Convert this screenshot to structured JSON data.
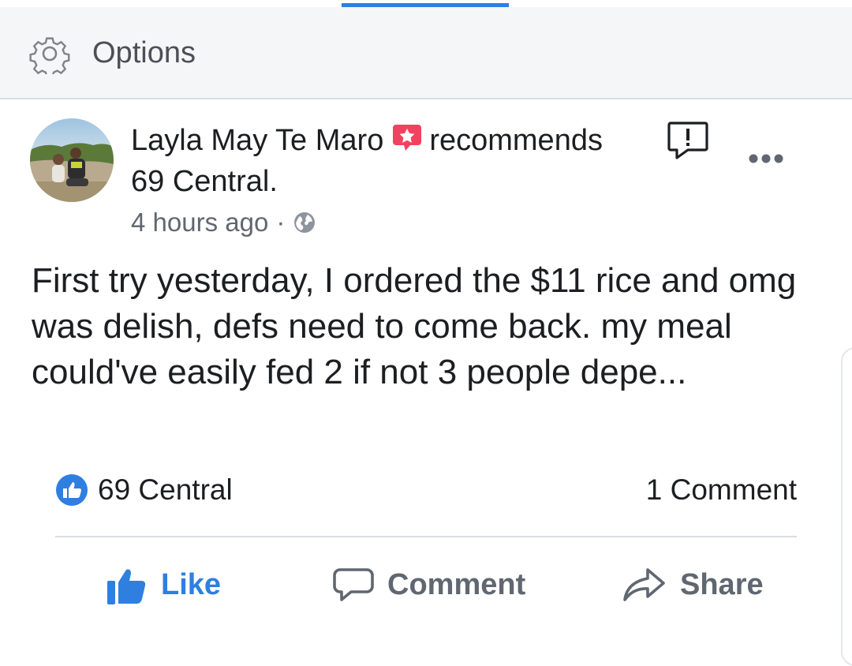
{
  "header": {
    "options_label": "Options",
    "options_icon": "gear-icon",
    "active_tab_color": "#2e7fe0"
  },
  "post": {
    "author": "Layla May Te Maro",
    "recommendation_icon": "recommendation-star-icon",
    "verb": "recommends",
    "place": "69 Central.",
    "time": "4 hours ago",
    "separator": "·",
    "privacy_icon": "globe-icon",
    "body": "First try yesterday, I ordered the $11 rice and omg was delish, defs need to come back. my meal could've easily fed 2 if not 3 people depe...",
    "flag_icon": "report-flag-icon",
    "more_icon": "more-options-icon"
  },
  "summary": {
    "likes_label": "69 Central",
    "comments_count": "1 Comment"
  },
  "actions": {
    "like": "Like",
    "comment": "Comment",
    "share": "Share"
  },
  "colors": {
    "accent": "#2e7fe0",
    "recommend_badge": "#f3425f",
    "text": "#1c1e21",
    "muted": "#606770"
  }
}
